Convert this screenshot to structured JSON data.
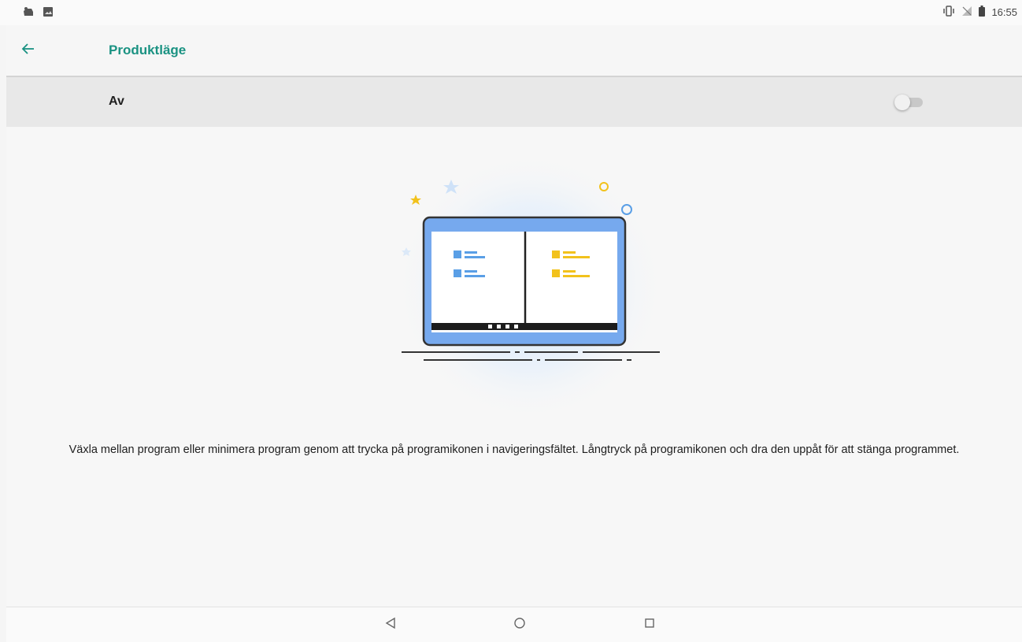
{
  "status_bar": {
    "time": "16:55",
    "left_icons": [
      "notification-icon",
      "image-icon"
    ],
    "right_icons": [
      "vibrate-icon",
      "no-signal-icon",
      "battery-icon"
    ]
  },
  "toolbar": {
    "title": "Produktläge",
    "back_icon": "back-arrow-icon"
  },
  "switch_row": {
    "label": "Av",
    "state": "off"
  },
  "description": "Växla mellan program eller minimera program genom att trycka på programikonen i navigeringsfältet. Långtryck på programikonen och dra den uppåt för att stänga programmet.",
  "navigation": {
    "buttons": [
      "back-nav-icon",
      "home-nav-icon",
      "recents-nav-icon"
    ]
  },
  "colors": {
    "accent": "#1a9282",
    "blue": "#5a9fe6",
    "yellow": "#f2c21c",
    "text": "#202020"
  }
}
